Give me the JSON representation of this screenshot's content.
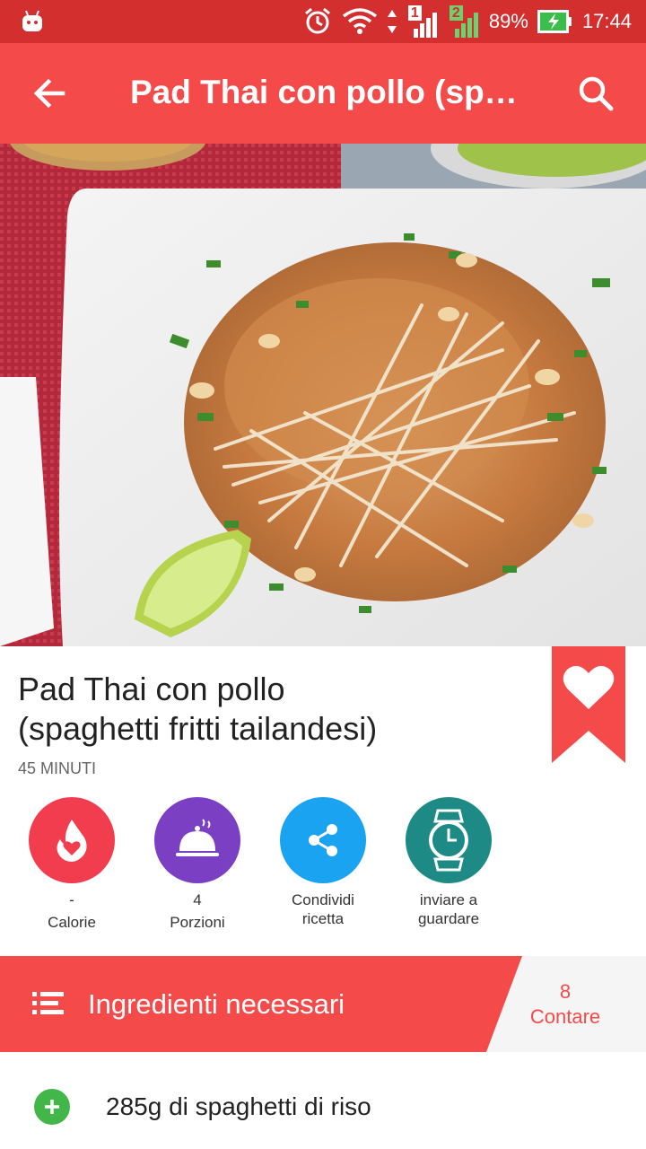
{
  "status_bar": {
    "battery": "89%",
    "time": "17:44",
    "sim1": "1",
    "sim2": "2",
    "icons": [
      "android-icon",
      "alarm-icon",
      "wifi-icon",
      "signal-icon",
      "battery-charging-icon"
    ]
  },
  "app_bar": {
    "title": "Pad Thai con pollo (sp…",
    "back_icon": "arrow-back-icon",
    "search_icon": "search-icon"
  },
  "recipe": {
    "title_line1": "Pad Thai con pollo",
    "title_line2": "(spaghetti fritti tailandesi)",
    "time": "45 MINUTI"
  },
  "actions": [
    {
      "icon": "flame-heart-icon",
      "color": "#f23d4f",
      "line1": "-",
      "line2": "Calorie"
    },
    {
      "icon": "cloche-icon",
      "color": "#7b3fc4",
      "line1": "4",
      "line2": "Porzioni"
    },
    {
      "icon": "share-icon",
      "color": "#1aa3f0",
      "line1": "Condividi",
      "line2": "ricetta"
    },
    {
      "icon": "watch-icon",
      "color": "#1e8a85",
      "line1": "inviare a",
      "line2": "guardare"
    }
  ],
  "ingredients_header": {
    "label": "Ingredienti necessari",
    "count_value": "8",
    "count_label": "Contare"
  },
  "ingredients": [
    {
      "text": "285g di spaghetti di riso"
    }
  ],
  "colors": {
    "accent": "#f44a4a",
    "status_bar": "#d32f2f",
    "add_green": "#43b649"
  }
}
